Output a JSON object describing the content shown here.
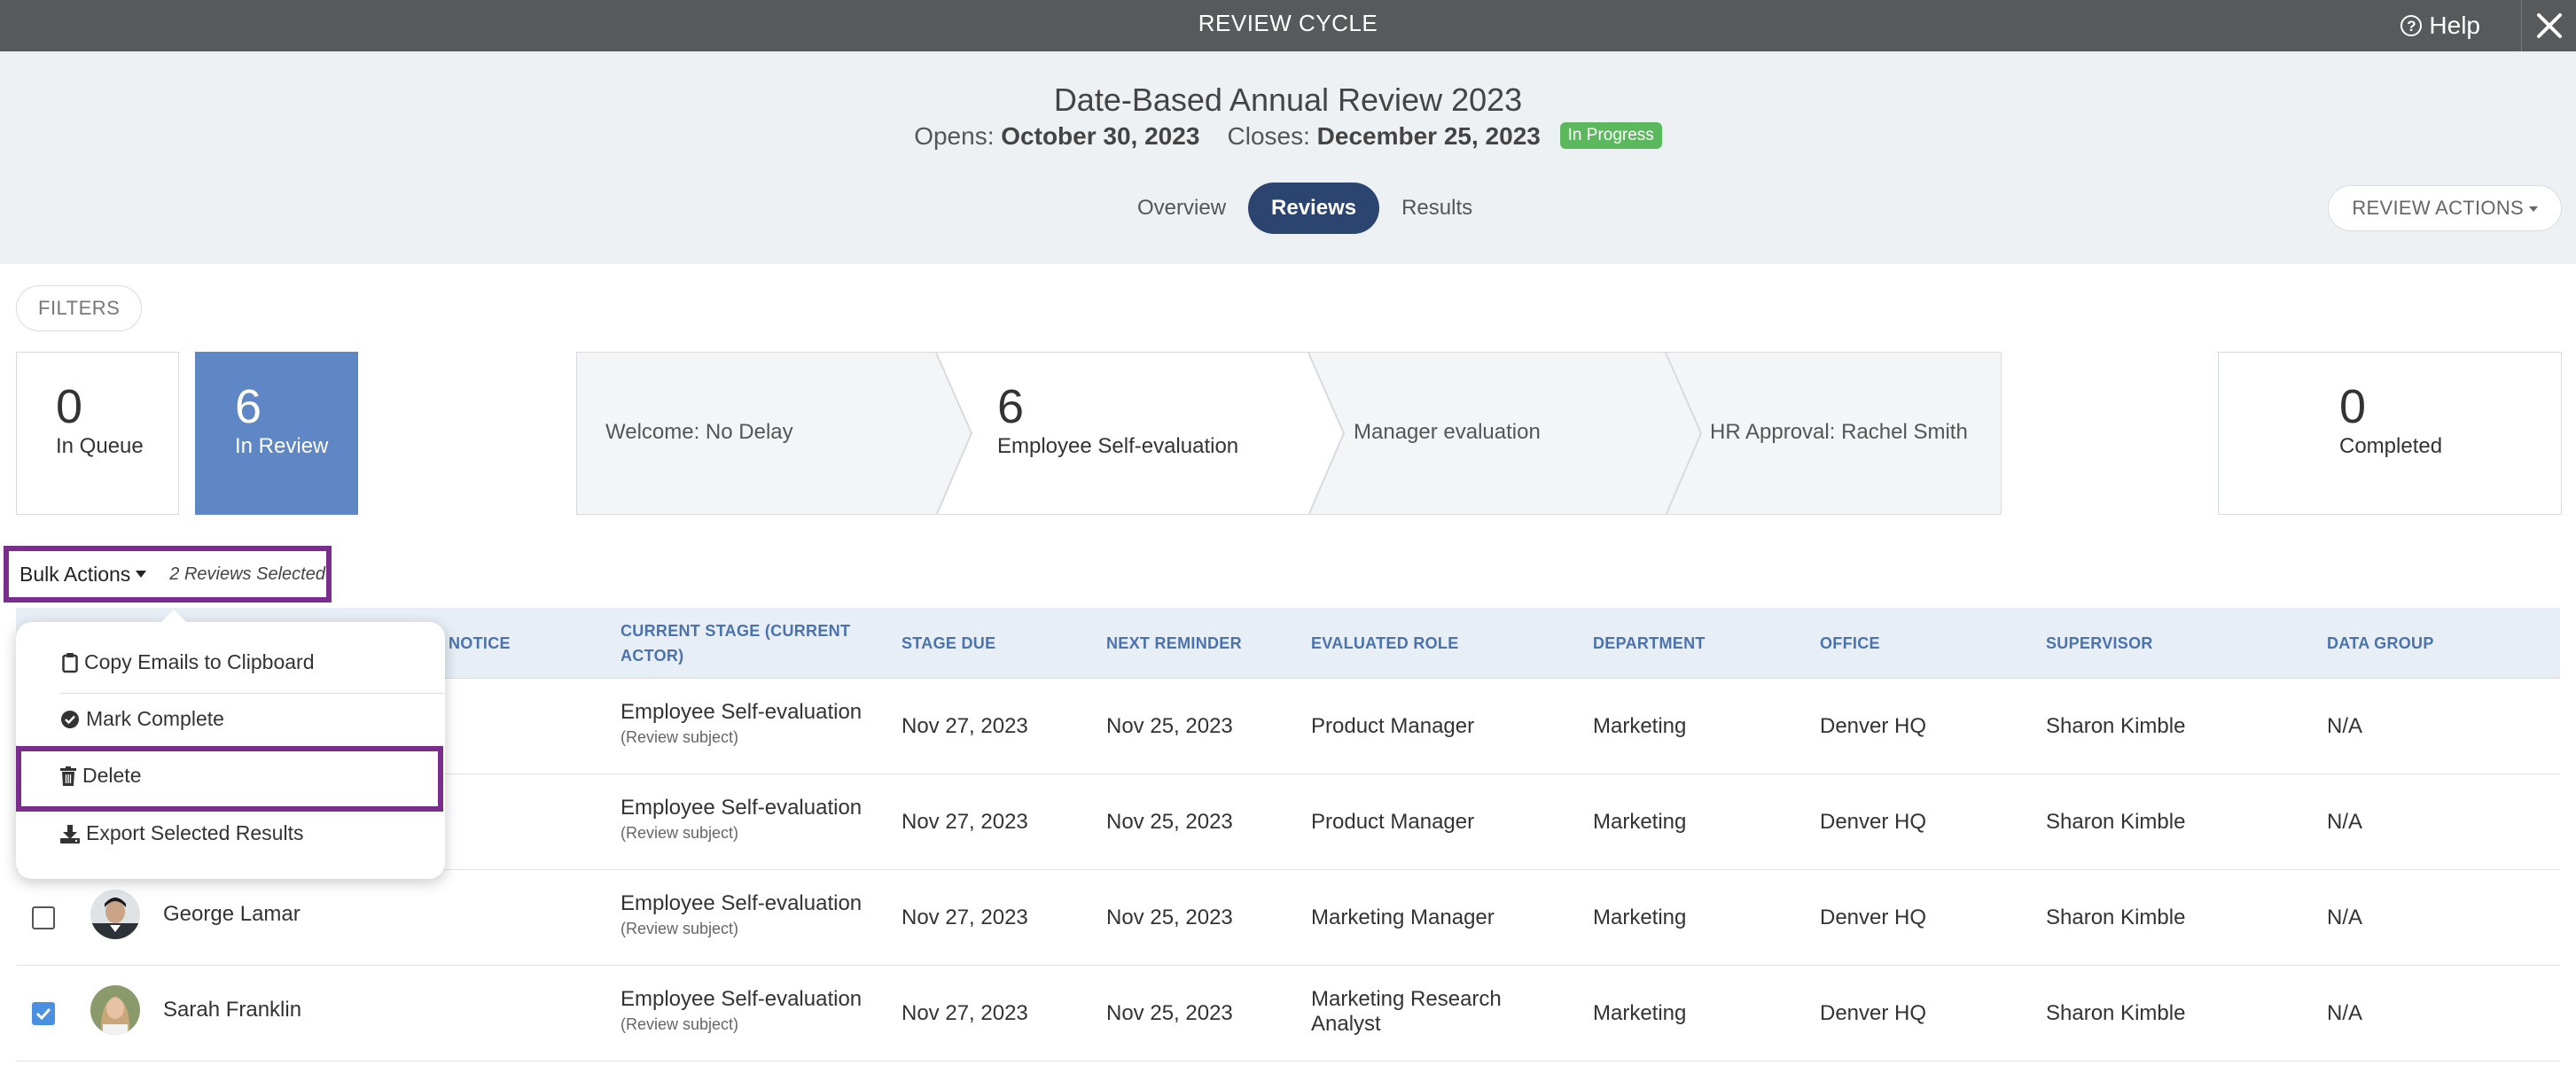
{
  "topbar": {
    "title": "REVIEW CYCLE",
    "help_label": "Help"
  },
  "header": {
    "title": "Date-Based Annual Review 2023",
    "opens_label": "Opens:",
    "opens_date": "October 30, 2023",
    "closes_label": "Closes:",
    "closes_date": "December 25, 2023",
    "status": "In Progress",
    "tabs": [
      {
        "label": "Overview",
        "active": false
      },
      {
        "label": "Reviews",
        "active": true
      },
      {
        "label": "Results",
        "active": false
      }
    ],
    "review_actions_label": "REVIEW ACTIONS"
  },
  "filters_label": "FILTERS",
  "summary": {
    "in_queue": {
      "count": "0",
      "label": "In Queue"
    },
    "in_review": {
      "count": "6",
      "label": "In Review"
    },
    "completed": {
      "count": "0",
      "label": "Completed"
    }
  },
  "pipeline": [
    {
      "label": "Welcome: No Delay",
      "count": ""
    },
    {
      "label": "Employee Self-evaluation",
      "count": "6"
    },
    {
      "label": "Manager evaluation",
      "count": ""
    },
    {
      "label": "HR Approval: Rachel Smith",
      "count": ""
    }
  ],
  "bulk_actions": {
    "label": "Bulk Actions",
    "selected_text": "2 Reviews Selected",
    "menu": [
      {
        "label": "Copy Emails to Clipboard",
        "icon": "clipboard-icon"
      },
      {
        "label": "Mark Complete",
        "icon": "check-circle-icon"
      },
      {
        "label": "Delete",
        "icon": "trash-icon"
      },
      {
        "label": "Export Selected Results",
        "icon": "download-icon"
      }
    ]
  },
  "table": {
    "columns": [
      "NOTICE",
      "CURRENT STAGE (CURRENT",
      "ACTOR)",
      "STAGE DUE",
      "NEXT REMINDER",
      "EVALUATED ROLE",
      "DEPARTMENT",
      "OFFICE",
      "SUPERVISOR",
      "DATA GROUP"
    ],
    "rows": [
      {
        "name": "",
        "checked": null,
        "stage": "Employee Self-evaluation",
        "actor": "(Review subject)",
        "stage_due": "Nov 27, 2023",
        "next_reminder": "Nov 25, 2023",
        "role": "Product Manager",
        "department": "Marketing",
        "office": "Denver HQ",
        "supervisor": "Sharon Kimble",
        "data_group": "N/A"
      },
      {
        "name": "",
        "checked": null,
        "stage": "Employee Self-evaluation",
        "actor": "(Review subject)",
        "stage_due": "Nov 27, 2023",
        "next_reminder": "Nov 25, 2023",
        "role": "Product Manager",
        "department": "Marketing",
        "office": "Denver HQ",
        "supervisor": "Sharon Kimble",
        "data_group": "N/A"
      },
      {
        "name": "George Lamar",
        "checked": false,
        "stage": "Employee Self-evaluation",
        "actor": "(Review subject)",
        "stage_due": "Nov 27, 2023",
        "next_reminder": "Nov 25, 2023",
        "role": "Marketing Manager",
        "department": "Marketing",
        "office": "Denver HQ",
        "supervisor": "Sharon Kimble",
        "data_group": "N/A"
      },
      {
        "name": "Sarah Franklin",
        "checked": true,
        "stage": "Employee Self-evaluation",
        "actor": "(Review subject)",
        "stage_due": "Nov 27, 2023",
        "next_reminder": "Nov 25, 2023",
        "role_line1": "Marketing Research",
        "role_line2": "Analyst",
        "department": "Marketing",
        "office": "Denver HQ",
        "supervisor": "Sharon Kimble",
        "data_group": "N/A"
      }
    ]
  },
  "colors": {
    "topbar": "#58595b",
    "accent_tab": "#2c4470",
    "in_review": "#5f86c5",
    "highlight": "#7b2d8e",
    "status_green": "#5cb85c",
    "header_text": "#4a72ad"
  }
}
